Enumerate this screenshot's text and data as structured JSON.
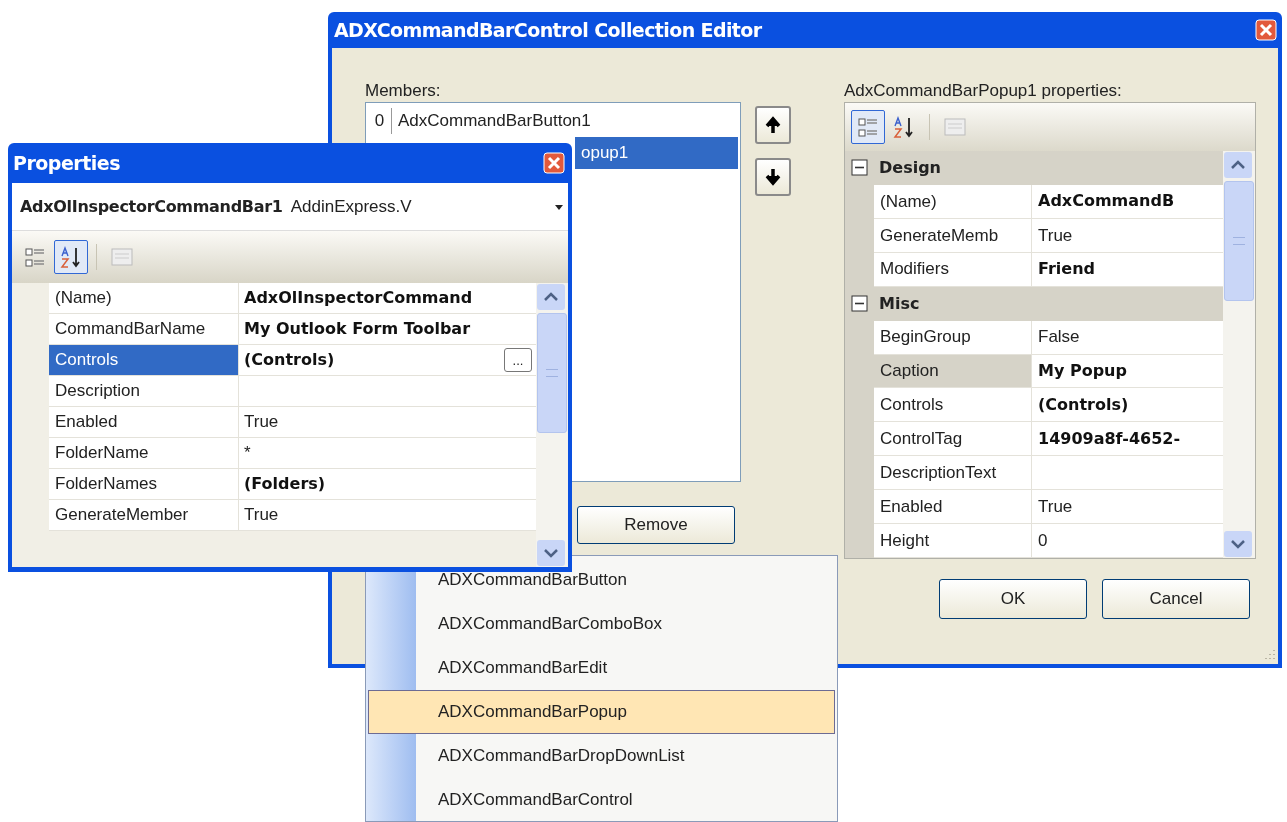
{
  "editor": {
    "title": "ADXCommandBarControl Collection Editor",
    "members_label": "Members:",
    "members": [
      {
        "index": "0",
        "label": "AdxCommandBarButton1",
        "selected": false
      },
      {
        "label": "opup1",
        "selected": true
      }
    ],
    "remove_button": "Remove",
    "properties_label": "AdxCommandBarPopup1 properties:",
    "toolbar": [
      {
        "kind": "categorized",
        "pressed": true
      },
      {
        "kind": "alphabetical",
        "pressed": false
      },
      {
        "kind": "pages",
        "pressed": false
      }
    ],
    "grid": [
      {
        "kind": "category",
        "label": "Design",
        "expanded": true
      },
      {
        "kind": "property",
        "name": "(Name)",
        "value": "AdxCommandB",
        "modified": true,
        "selected": false
      },
      {
        "kind": "property",
        "name": "GenerateMemb",
        "value": "True",
        "modified": false,
        "selected": false
      },
      {
        "kind": "property",
        "name": "Modifiers",
        "value": "Friend",
        "modified": true,
        "selected": false
      },
      {
        "kind": "category",
        "label": "Misc",
        "expanded": true
      },
      {
        "kind": "property",
        "name": "BeginGroup",
        "value": "False",
        "modified": false,
        "selected": false
      },
      {
        "kind": "property",
        "name": "Caption",
        "value": "My Popup",
        "modified": true,
        "selected": true
      },
      {
        "kind": "property",
        "name": "Controls",
        "value": "(Controls)",
        "modified": true,
        "selected": false
      },
      {
        "kind": "property",
        "name": "ControlTag",
        "value": "14909a8f-4652-",
        "modified": true,
        "selected": false
      },
      {
        "kind": "property",
        "name": "DescriptionText",
        "selected": false
      },
      {
        "kind": "property",
        "name": "Enabled",
        "value": "True",
        "modified": false,
        "selected": false
      },
      {
        "kind": "property",
        "name": "Height",
        "value": "0",
        "modified": false,
        "selected": false
      }
    ],
    "buttons": [
      "OK",
      "Cancel"
    ]
  },
  "properties_window": {
    "title": "Properties",
    "object_name": "AdxOlInspectorCommandBar1",
    "object_type": "AddinExpress.V",
    "toolbar": [
      {
        "kind": "categorized",
        "pressed": false
      },
      {
        "kind": "alphabetical",
        "pressed": true
      },
      {
        "kind": "pages",
        "pressed": false
      }
    ],
    "grid": [
      {
        "name": "(Name)",
        "value": "AdxOlInspectorCommand",
        "modified": true,
        "selected": false
      },
      {
        "name": "CommandBarName",
        "value": "My Outlook Form Toolbar",
        "modified": true,
        "selected": false
      },
      {
        "name": "Controls",
        "value": "(Controls)",
        "modified": true,
        "selected": true,
        "button": "..."
      },
      {
        "name": "Description",
        "selected": false
      },
      {
        "name": "Enabled",
        "value": "True",
        "modified": false,
        "selected": false
      },
      {
        "name": "FolderName",
        "value": "*",
        "modified": false,
        "selected": false
      },
      {
        "name": "FolderNames",
        "value": "(Folders)",
        "modified": true,
        "selected": false
      },
      {
        "name": "GenerateMember",
        "value": "True",
        "modified": false,
        "selected": false
      }
    ]
  },
  "menu": [
    {
      "label": "ADXCommandBarButton",
      "selected": false
    },
    {
      "label": "ADXCommandBarComboBox",
      "selected": false
    },
    {
      "label": "ADXCommandBarEdit",
      "selected": false
    },
    {
      "label": "ADXCommandBarPopup",
      "selected": true
    },
    {
      "label": "ADXCommandBarDropDownList",
      "selected": false
    },
    {
      "label": "ADXCommandBarControl",
      "selected": false
    }
  ]
}
